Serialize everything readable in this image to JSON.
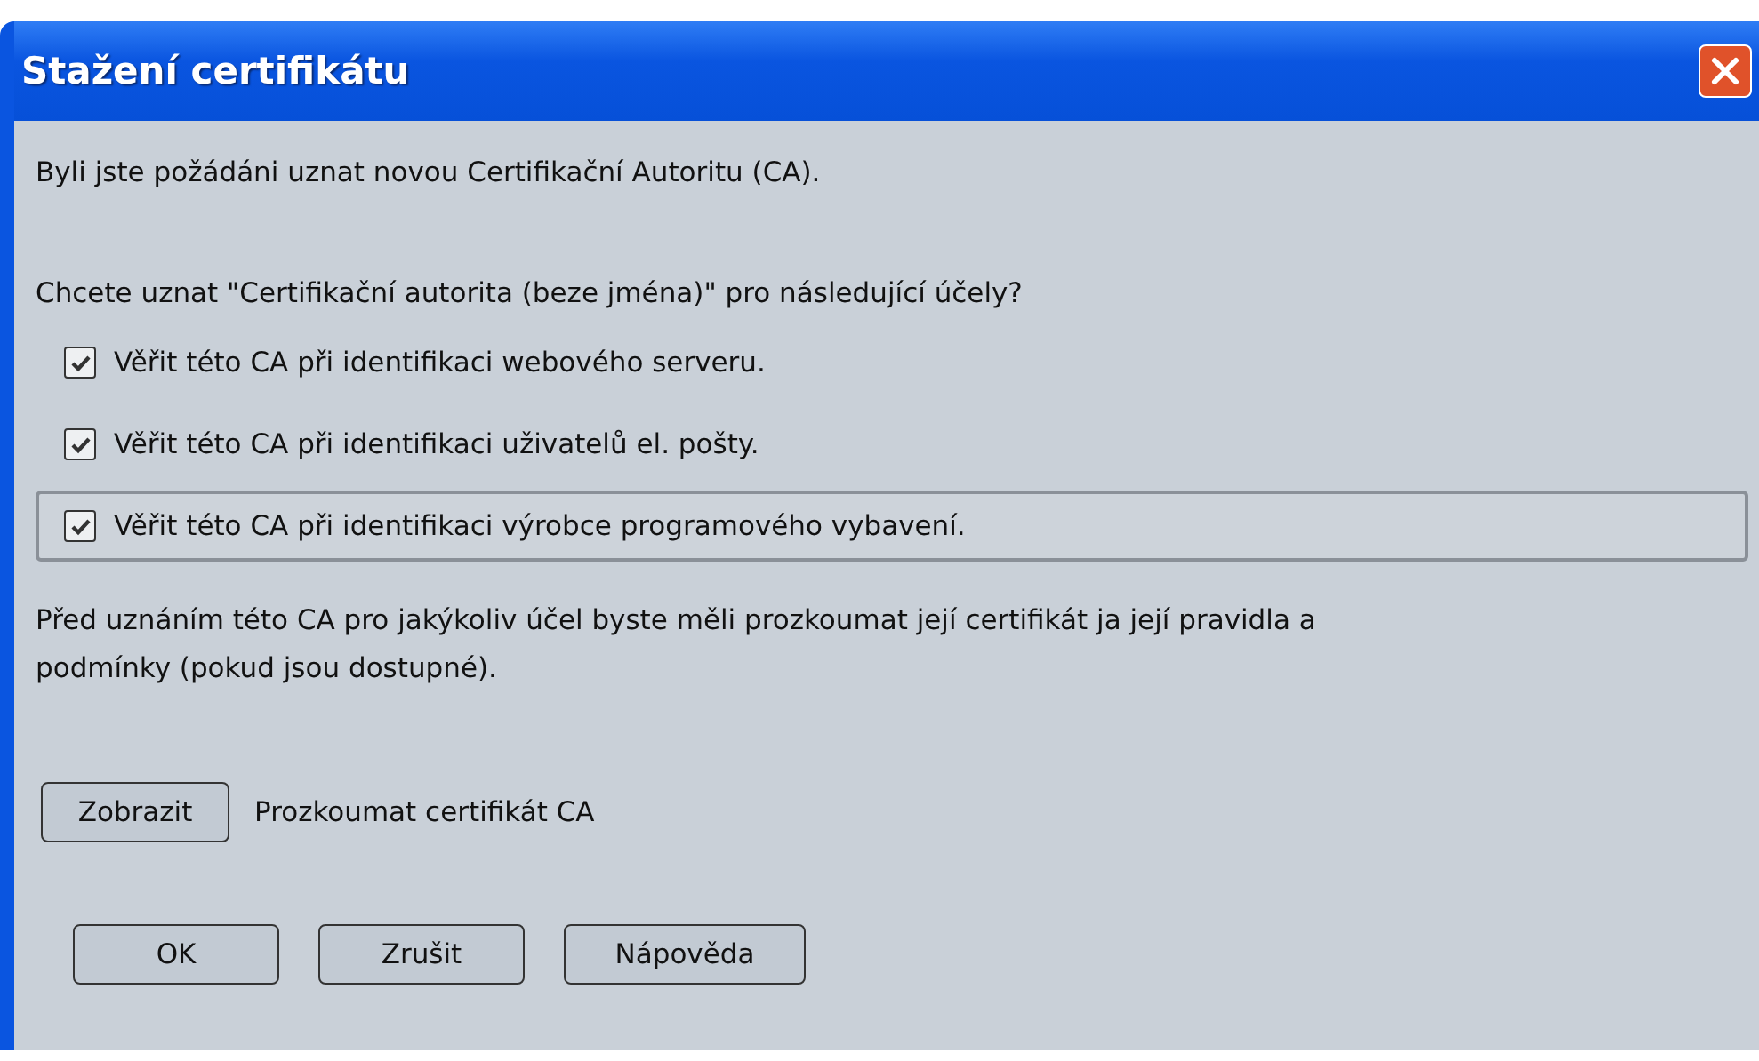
{
  "window": {
    "title": "Stažení certifikátu"
  },
  "intro": "Byli jste požádáni uznat novou Certifikační Autoritu (CA).",
  "question": "Chcete uznat \"Certifikační autorita (beze jména)\" pro následující účely?",
  "options": [
    {
      "label": "Věřit této CA při identifikaci webového serveru.",
      "checked": true,
      "focused": false
    },
    {
      "label": "Věřit této CA při identifikaci uživatelů el. pošty.",
      "checked": true,
      "focused": false
    },
    {
      "label": "Věřit této CA při identifikaci výrobce programového vybavení.",
      "checked": true,
      "focused": true
    }
  ],
  "advice": "Před uznáním této CA pro jakýkoliv účel byste měli prozkoumat její certifikát ja její pravidla a podmínky (pokud jsou dostupné).",
  "view": {
    "button": "Zobrazit",
    "label": "Prozkoumat certifikát CA"
  },
  "buttons": [
    "OK",
    "Zrušit",
    "Nápověda"
  ]
}
